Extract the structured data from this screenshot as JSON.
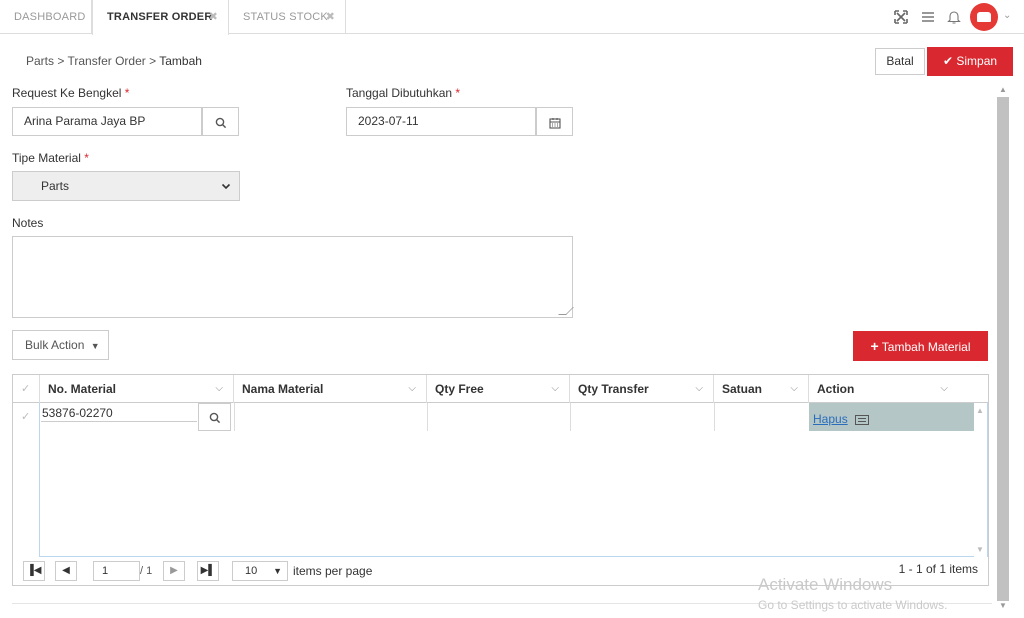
{
  "tabs": [
    {
      "label": "DASHBOARD",
      "closable": false,
      "active": false
    },
    {
      "label": "TRANSFER ORDER",
      "closable": true,
      "active": true
    },
    {
      "label": "STATUS STOCK",
      "closable": true,
      "active": false
    }
  ],
  "tab_close_glyph": "✖",
  "top_icons": [
    "fullscreen-icon",
    "menu-icon",
    "bell-icon",
    "avatar-car-icon"
  ],
  "breadcrumb": {
    "part1": "Parts",
    "part2": "Transfer Order",
    "part3": "Tambah",
    "sep": ">"
  },
  "actions": {
    "batal": "Batal",
    "simpan": "Simpan"
  },
  "form": {
    "request_label": "Request Ke Bengkel",
    "request_value": "Arina Parama Jaya BP",
    "tanggal_label": "Tanggal Dibutuhkan",
    "tanggal_value": "2023-07-11",
    "tipe_label": "Tipe Material",
    "tipe_value": "Parts",
    "notes_label": "Notes",
    "notes_value": "",
    "required_mark": "*"
  },
  "bulk_action": "Bulk Action",
  "tambah_material": "Tambah Material",
  "grid": {
    "columns": [
      "No. Material",
      "Nama Material",
      "Qty Free",
      "Qty Transfer",
      "Satuan",
      "Action"
    ],
    "rows": [
      {
        "no_material": "53876-02270",
        "nama_material": "",
        "qty_free": "",
        "qty_transfer": "",
        "satuan": "",
        "action": "Hapus"
      }
    ]
  },
  "pager": {
    "page": "1",
    "of": "/ 1",
    "page_size": "10",
    "per_page_label": "items per page",
    "info": "1 - 1 of 1 items"
  },
  "watermark": {
    "line1": "Activate Windows",
    "line2": "Go to Settings to activate Windows."
  },
  "colors": {
    "accent": "#d9282f",
    "action_cell": "#b4c6c6",
    "link": "#2a6ebb"
  }
}
